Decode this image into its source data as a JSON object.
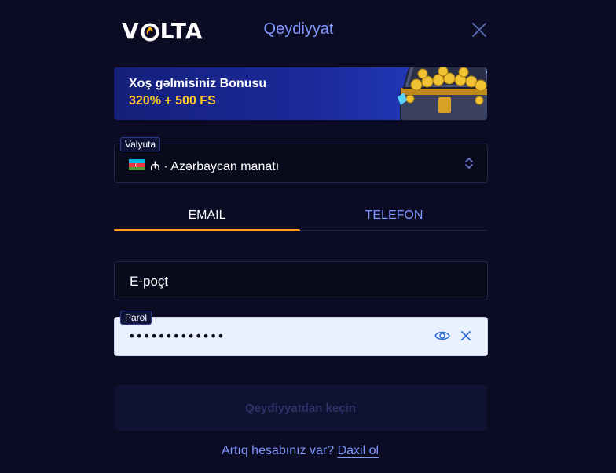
{
  "header": {
    "logo": {
      "prefix": "V",
      "suffix": "LTA"
    },
    "title": "Qeydiyyat",
    "close_icon": "close-icon"
  },
  "banner": {
    "title": "Xoş gəlmisiniz Bonusu",
    "bonus": "320% + 500 FS",
    "image_icon": "treasure-chest-icon"
  },
  "currency": {
    "label": "Valyuta",
    "value": "₼ · Azərbaycan manatı",
    "flag": "azerbaijan-flag-icon"
  },
  "tabs": [
    {
      "label": "EMAIL",
      "active": true
    },
    {
      "label": "TELEFON",
      "active": false
    }
  ],
  "form": {
    "email_placeholder": "E-poçt",
    "password_label": "Parol",
    "password_value": "•••••••••••••"
  },
  "submit_label": "Qeydiyyatdan keçin",
  "footer": {
    "question": "Artıq hesabınız var?",
    "link": "Daxil ol"
  },
  "colors": {
    "background": "#0b0b24",
    "accent": "#7f97ff",
    "tab_underline": "#ffa41c",
    "bonus": "#ffc629"
  }
}
